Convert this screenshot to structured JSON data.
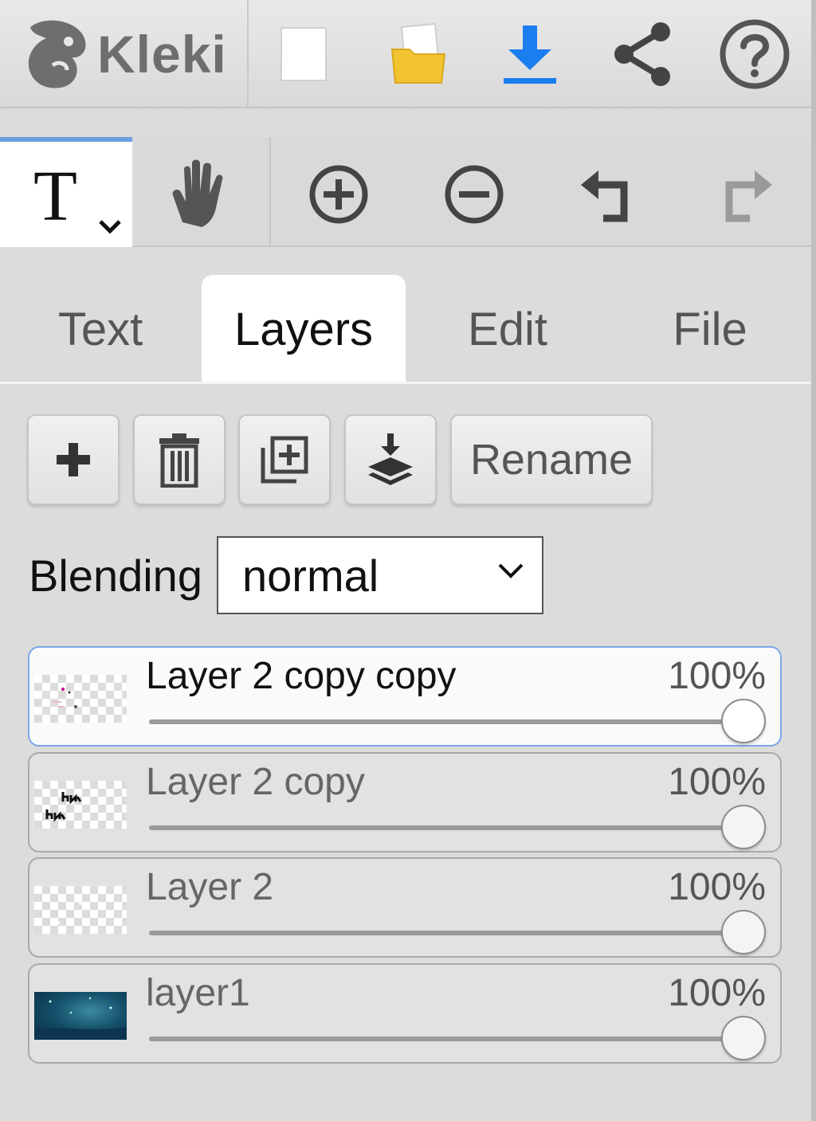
{
  "app": {
    "name": "Kleki"
  },
  "toolbar": {
    "new_label": "new-image",
    "open_label": "open-file",
    "save_label": "download",
    "share_label": "share",
    "help_label": "help"
  },
  "tools": {
    "active_tool": "T",
    "icons": [
      "text-tool-icon",
      "hand-tool-icon",
      "zoom-in-icon",
      "zoom-out-icon",
      "undo-icon",
      "redo-icon"
    ]
  },
  "tabs": [
    {
      "label": "Text"
    },
    {
      "label": "Layers"
    },
    {
      "label": "Edit"
    },
    {
      "label": "File"
    }
  ],
  "layer_panel": {
    "rename_label": "Rename",
    "blending_label": "Blending",
    "blending_value": "normal"
  },
  "layers": [
    {
      "name": "Layer 2 copy copy",
      "opacity_label": "100%",
      "opacity": 1.0,
      "active": true
    },
    {
      "name": "Layer 2 copy",
      "opacity_label": "100%",
      "opacity": 1.0,
      "active": false
    },
    {
      "name": "Layer 2",
      "opacity_label": "100%",
      "opacity": 1.0,
      "active": false
    },
    {
      "name": "layer1",
      "opacity_label": "100%",
      "opacity": 1.0,
      "active": false
    }
  ],
  "colors": {
    "accent": "#6a9fe0",
    "download": "#1a7ef0",
    "folder": "#f3c431"
  }
}
